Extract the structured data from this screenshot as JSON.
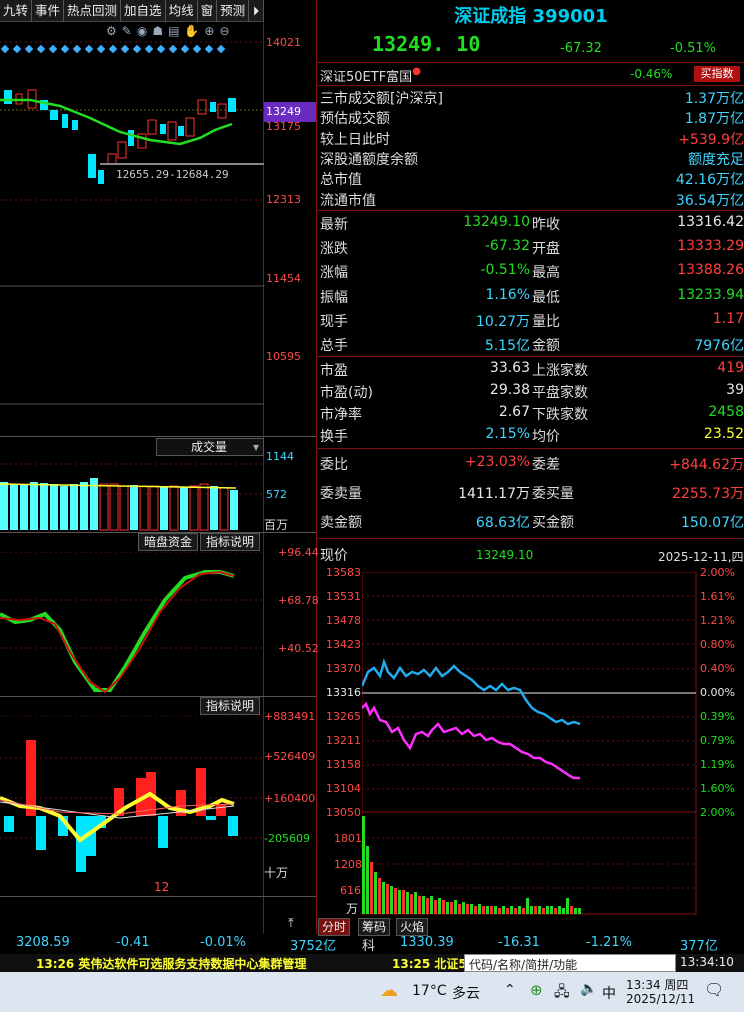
{
  "toolbar": {
    "items": [
      "九转",
      "事件",
      "热点回测",
      "加自选",
      "均线",
      "窗",
      "预测"
    ],
    "collapse_icon": "collapse-icon"
  },
  "kline": {
    "axis": [
      "14021",
      "13249",
      "13175",
      "12313",
      "11454",
      "10595"
    ],
    "range_label": "12655.29-12684.29",
    "current_tag": "13249"
  },
  "volume_panel": {
    "selector": "成交量",
    "axis": [
      "1144",
      "572",
      "百万"
    ]
  },
  "indicator1": {
    "tabs": [
      "暗盘资金",
      "指标说明"
    ],
    "axis": [
      "+96.44",
      "+68.78",
      "+40.52"
    ]
  },
  "indicator2": {
    "tab": "指标说明",
    "axis": [
      "+883491",
      "+526409",
      "+160400",
      "-205609",
      "十万"
    ],
    "date_label": "12"
  },
  "quote": {
    "title": "深证成指 399001",
    "price": "13249. 10",
    "change": "-67.32",
    "pct": "-0.51%",
    "etf_name": "深证50ETF富国",
    "etf_pct": "-0.46%",
    "etf_button": "买指数",
    "rows": [
      {
        "label": "三市成交额[沪深京]",
        "value": "1.37万亿",
        "color": "#3fd5ff"
      },
      {
        "label": "预估成交额",
        "value": "1.87万亿",
        "color": "#3fd5ff"
      },
      {
        "label": "较上日此时",
        "value": "+539.9亿",
        "color": "#ff4040"
      },
      {
        "label": "深股通额度余额",
        "value": "额度充足",
        "color": "#3fd5ff"
      },
      {
        "label": "总市值",
        "value": "42.16万亿",
        "color": "#3fd5ff"
      },
      {
        "label": "流通市值",
        "value": "36.54万亿",
        "color": "#3fd5ff"
      }
    ],
    "stats": [
      {
        "l1": "最新",
        "v1": "13249.10",
        "c1": "#22dd22",
        "l2": "昨收",
        "v2": "13316.42",
        "c2": "#e8e8e8"
      },
      {
        "l1": "涨跌",
        "v1": "-67.32",
        "c1": "#22dd22",
        "l2": "开盘",
        "v2": "13333.29",
        "c2": "#ff4040"
      },
      {
        "l1": "涨幅",
        "v1": "-0.51%",
        "c1": "#22dd22",
        "l2": "最高",
        "v2": "13388.26",
        "c2": "#ff4040"
      },
      {
        "l1": "振幅",
        "v1": "1.16%",
        "c1": "#3fd5ff",
        "l2": "最低",
        "v2": "13233.94",
        "c2": "#22dd22"
      },
      {
        "l1": "现手",
        "v1": "10.27万",
        "c1": "#3fd5ff",
        "l2": "量比",
        "v2": "1.17",
        "c2": "#ff4040"
      },
      {
        "l1": "总手",
        "v1": "5.15亿",
        "c1": "#3fd5ff",
        "l2": "金额",
        "v2": "7976亿",
        "c2": "#3fd5ff"
      }
    ],
    "stats2": [
      {
        "l1": "市盈",
        "v1": "33.63",
        "c1": "#e8e8e8",
        "l2": "上涨家数",
        "v2": "419",
        "c2": "#ff4040"
      },
      {
        "l1": "市盈(动)",
        "v1": "29.38",
        "c1": "#e8e8e8",
        "l2": "平盘家数",
        "v2": "39",
        "c2": "#e8e8e8"
      },
      {
        "l1": "市净率",
        "v1": "2.67",
        "c1": "#e8e8e8",
        "l2": "下跌家数",
        "v2": "2458",
        "c2": "#22dd22"
      },
      {
        "l1": "换手",
        "v1": "2.15%",
        "c1": "#3fd5ff",
        "l2": "均价",
        "v2": "23.52",
        "c2": "#ffff30"
      }
    ],
    "stats3": [
      {
        "l1": "委比",
        "v1": "+23.03%",
        "c1": "#ff4040",
        "l2": "委差",
        "v2": "+844.62万",
        "c2": "#ff4040"
      },
      {
        "l1": "委卖量",
        "v1": "1411.17万",
        "c1": "#e8e8e8",
        "l2": "委买量",
        "v2": "2255.73万",
        "c2": "#ff4040"
      },
      {
        "l1": "卖金额",
        "v1": "68.63亿",
        "c1": "#3fd5ff",
        "l2": "买金额",
        "v2": "150.07亿",
        "c2": "#3fd5ff"
      }
    ]
  },
  "intraday": {
    "label": "现价",
    "price": "13249.10",
    "date": "2025-12-11,四",
    "left_axis": [
      "13583",
      "13531",
      "13478",
      "13423",
      "13370",
      "13316",
      "13265",
      "13211",
      "13158",
      "13104",
      "13050"
    ],
    "right_axis": [
      "2.00%",
      "1.61%",
      "1.21%",
      "0.80%",
      "0.40%",
      "0.00%",
      "0.39%",
      "0.79%",
      "1.19%",
      "1.60%",
      "2.00%"
    ],
    "vol_axis": [
      "1801",
      "1208",
      "616",
      "万"
    ],
    "tabs": [
      "分时",
      "筹码",
      "火焰"
    ]
  },
  "bottom_index": {
    "left": {
      "value": "3208.59",
      "change": "-0.41",
      "pct": "-0.01%",
      "amount": "3752亿"
    },
    "right": {
      "name": "科",
      "value": "1330.39",
      "change": "-16.31",
      "pct": "-1.21%",
      "amount": "377亿"
    }
  },
  "ticker": {
    "msg1": "13:26 英伟达软件可选服务支持数据中心集群管理",
    "msg2": "13:25 北证5",
    "search_placeholder": "代码/名称/简拼/功能",
    "time": "13:34:10"
  },
  "taskbar": {
    "temp": "17°C",
    "weather": "多云",
    "ime": "中",
    "time": "13:34 周四",
    "date": "2025/12/11"
  }
}
